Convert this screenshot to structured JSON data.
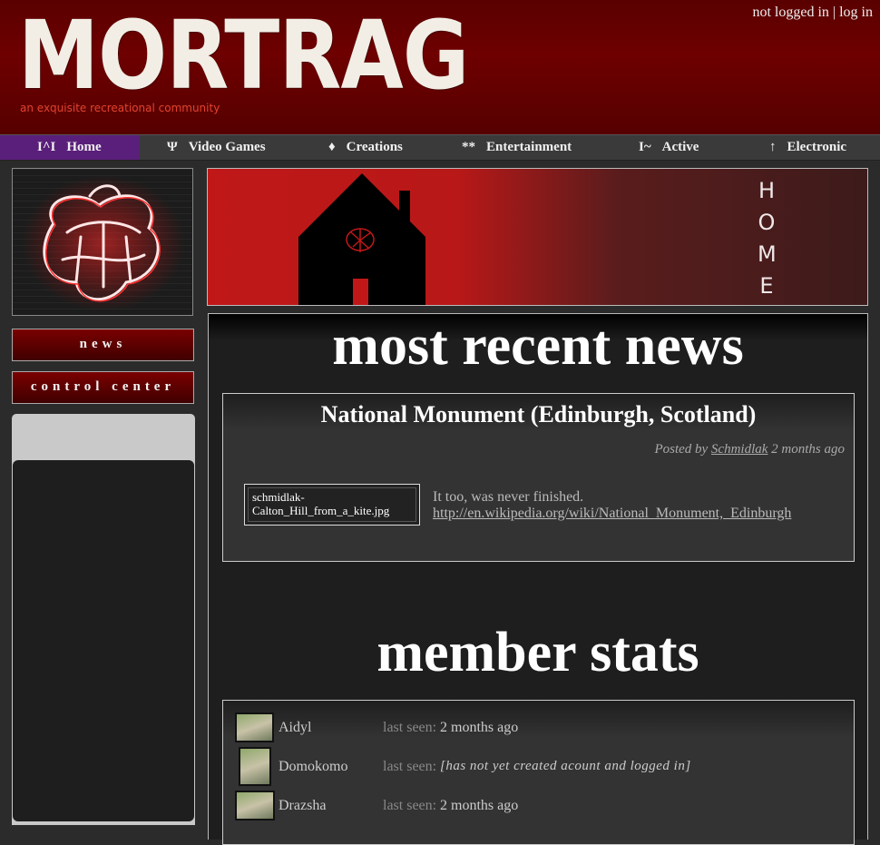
{
  "header": {
    "logo_text": "MORTRAG",
    "tagline": "an exquisite recreational community",
    "login_status": "not logged in",
    "login_separator": "|",
    "login_link": "log in",
    "accent": "#6e0000"
  },
  "nav": {
    "items": [
      {
        "glyph": "I^I",
        "label": "Home",
        "icon": "home-glyph-icon",
        "active": true
      },
      {
        "glyph": "Ψ",
        "label": "Video Games",
        "icon": "psi-icon"
      },
      {
        "glyph": "♦",
        "label": "Creations",
        "icon": "diamond-icon"
      },
      {
        "glyph": "**",
        "label": "Entertainment",
        "icon": "stars-icon"
      },
      {
        "glyph": "I~",
        "label": "Active",
        "icon": "wave-icon"
      },
      {
        "glyph": "↑",
        "label": "Electronic",
        "icon": "arrow-up-icon"
      }
    ],
    "active_color": "#5a1f7a"
  },
  "sidebar": {
    "news_label": "news",
    "control_center_label": "control center"
  },
  "banner": {
    "letters": [
      "H",
      "O",
      "M",
      "E"
    ]
  },
  "news": {
    "heading": "most recent news",
    "title": "National Monument (Edinburgh, Scotland)",
    "posted_by_label": "Posted by",
    "author": "Schmidlak",
    "time": "2 months ago",
    "image_alt": "schmidlak-Calton_Hill_from_a_kite.jpg",
    "body": "It too, was never finished.",
    "link": "http://en.wikipedia.org/wiki/National_Monument,_Edinburgh"
  },
  "stats": {
    "heading": "member stats",
    "last_seen_label": "last seen:",
    "members": [
      {
        "name": "Aidyl",
        "last_seen": "2 months ago"
      },
      {
        "name": "Domokomo",
        "last_seen": "[has not yet created acount and logged in]"
      },
      {
        "name": "Drazsha",
        "last_seen": "2 months ago"
      }
    ]
  }
}
